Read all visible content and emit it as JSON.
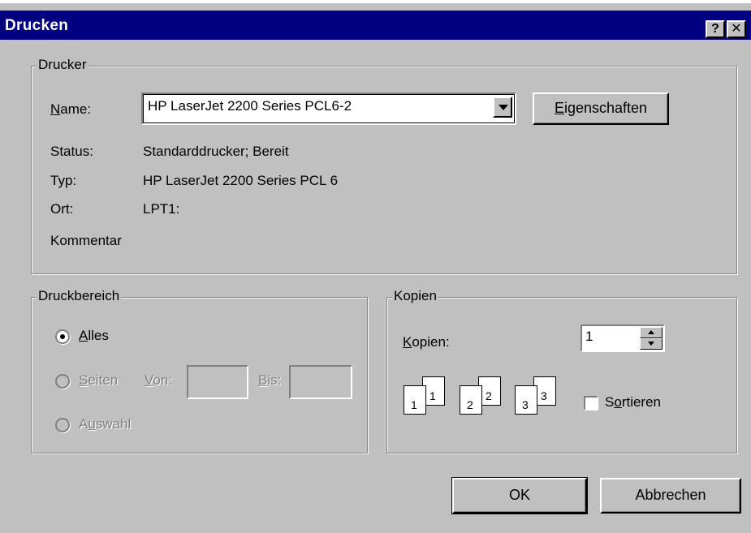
{
  "window": {
    "title": "Drucken",
    "help_label": "?",
    "close_label": "✕"
  },
  "printer": {
    "group_label": "Drucker",
    "name_label": "Name:",
    "name_value": "HP LaserJet 2200 Series PCL6-2",
    "properties_button": "Eigenschaften",
    "status_label": "Status:",
    "status_value": "Standarddrucker; Bereit",
    "type_label": "Typ:",
    "type_value": "HP LaserJet 2200 Series PCL 6",
    "location_label": "Ort:",
    "location_value": "LPT1:",
    "comment_label": "Kommentar",
    "comment_value": ""
  },
  "range": {
    "group_label": "Druckbereich",
    "all_label": "Alles",
    "pages_label": "Seiten",
    "from_label": "Von:",
    "from_value": "",
    "to_label": "Bis:",
    "to_value": "",
    "selection_label": "Auswahl",
    "selected": "all"
  },
  "copies": {
    "group_label": "Kopien",
    "copies_label": "Kopien:",
    "copies_value": "1",
    "collate_label": "Sortieren",
    "collate_checked": false,
    "collate_pages": [
      {
        "back": "1",
        "front": "1"
      },
      {
        "back": "2",
        "front": "2"
      },
      {
        "back": "3",
        "front": "3"
      }
    ]
  },
  "buttons": {
    "ok": "OK",
    "cancel": "Abbrechen"
  }
}
